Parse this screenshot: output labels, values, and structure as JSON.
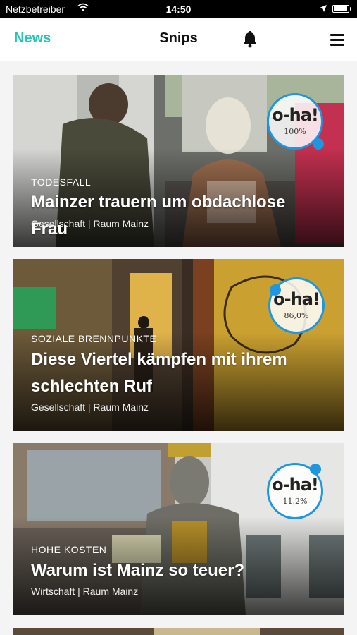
{
  "status_bar": {
    "carrier": "Netzbetreiber",
    "time": "14:50"
  },
  "nav": {
    "left": "News",
    "title": "Snips"
  },
  "articles": [
    {
      "kicker": "TODESFALL",
      "title": "Mainzer trauern um obdachlose Frau",
      "category": "Gesellschaft | Raum Mainz",
      "badge_label": "o-ha!",
      "badge_value": "100%"
    },
    {
      "kicker": "SOZIALE BRENNPUNKTE",
      "title": "Diese Viertel kämpfen mit ihrem schlechten Ruf",
      "category": "Gesellschaft | Raum Mainz",
      "badge_label": "o-ha!",
      "badge_value": "86,0%"
    },
    {
      "kicker": "HOHE KOSTEN",
      "title": "Warum ist Mainz so teuer?",
      "category": "Wirtschaft | Raum Mainz",
      "badge_label": "o-ha!",
      "badge_value": "11,2%"
    }
  ]
}
